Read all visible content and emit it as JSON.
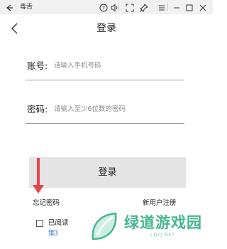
{
  "titlebar": {
    "title": "毒舌",
    "icons": [
      "back-arrow-icon",
      "help-icon",
      "volume-icon",
      "fullscreen-icon",
      "pin-icon",
      "menu-icon",
      "minimize-icon",
      "maximize-icon",
      "close-icon"
    ]
  },
  "header": {
    "title": "登录"
  },
  "form": {
    "account_label": "账号:",
    "account_placeholder": "请输入手机号码",
    "password_label": "密码:",
    "password_placeholder": "请输入至少6位数的密码",
    "login_label": "登录"
  },
  "links": {
    "forgot": "忘记密码",
    "register": "新用户注册"
  },
  "agreement": {
    "read_label": "已阅读",
    "policy_label": "策》"
  },
  "watermark": {
    "text": "绿道游戏园",
    "sub": "LDYJ.NET"
  },
  "colors": {
    "button_bg": "#e4e4e4",
    "annotation_red": "#e8434a",
    "watermark_green": "#46b78d",
    "link_blue": "#3a7bd5"
  }
}
